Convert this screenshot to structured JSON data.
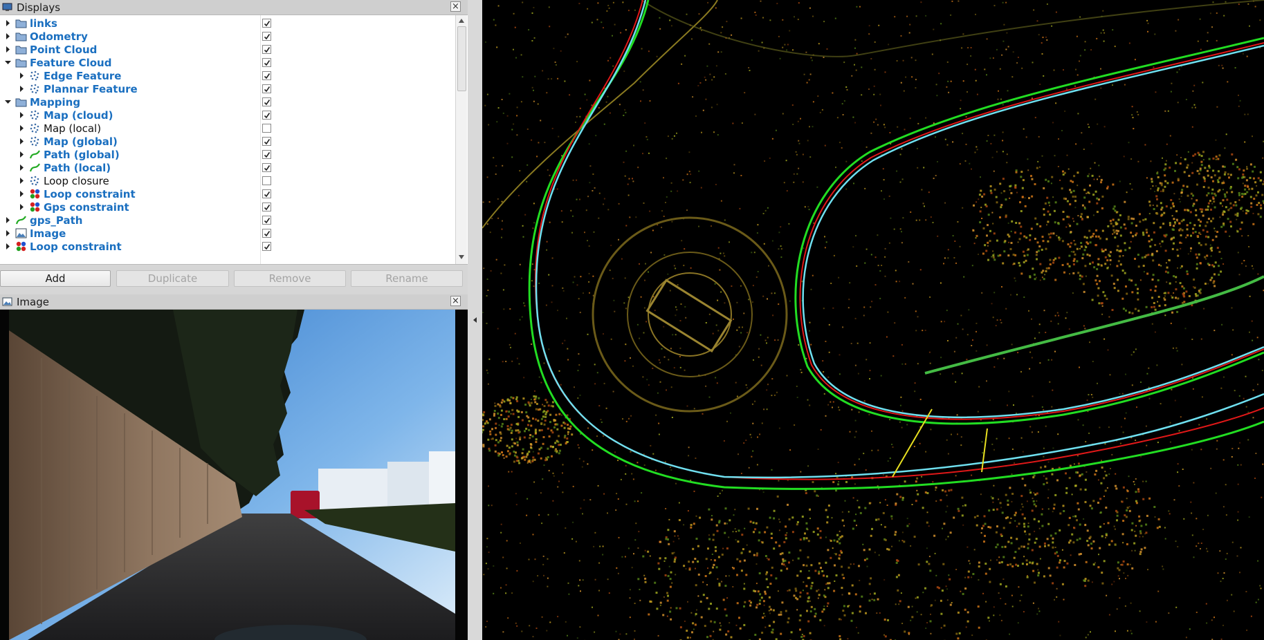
{
  "displays_panel": {
    "title": "Displays",
    "close_glyph": "×",
    "items": [
      {
        "label": "links",
        "indent": 0,
        "icon": "folder-icon",
        "expanded": false,
        "checked": true,
        "enabled": true
      },
      {
        "label": "Odometry",
        "indent": 0,
        "icon": "folder-icon",
        "expanded": false,
        "checked": true,
        "enabled": true
      },
      {
        "label": "Point Cloud",
        "indent": 0,
        "icon": "folder-icon",
        "expanded": false,
        "checked": true,
        "enabled": true
      },
      {
        "label": "Feature Cloud",
        "indent": 0,
        "icon": "folder-icon",
        "expanded": true,
        "checked": true,
        "enabled": true
      },
      {
        "label": "Edge Feature",
        "indent": 1,
        "icon": "pointcloud-icon",
        "expanded": false,
        "checked": true,
        "enabled": true
      },
      {
        "label": "Plannar Feature",
        "indent": 1,
        "icon": "pointcloud-icon",
        "expanded": false,
        "checked": true,
        "enabled": true
      },
      {
        "label": "Mapping",
        "indent": 0,
        "icon": "folder-icon",
        "expanded": true,
        "checked": true,
        "enabled": true
      },
      {
        "label": "Map (cloud)",
        "indent": 1,
        "icon": "pointcloud-icon",
        "expanded": false,
        "checked": true,
        "enabled": true
      },
      {
        "label": "Map (local)",
        "indent": 1,
        "icon": "pointcloud-icon",
        "expanded": false,
        "checked": false,
        "enabled": false
      },
      {
        "label": "Map (global)",
        "indent": 1,
        "icon": "pointcloud-icon",
        "expanded": false,
        "checked": true,
        "enabled": true
      },
      {
        "label": "Path (global)",
        "indent": 1,
        "icon": "path-icon",
        "expanded": false,
        "checked": true,
        "enabled": true
      },
      {
        "label": "Path (local)",
        "indent": 1,
        "icon": "path-icon",
        "expanded": false,
        "checked": true,
        "enabled": true
      },
      {
        "label": "Loop closure",
        "indent": 1,
        "icon": "pointcloud-icon",
        "expanded": false,
        "checked": false,
        "enabled": false
      },
      {
        "label": "Loop constraint",
        "indent": 1,
        "icon": "marker-icon",
        "expanded": false,
        "checked": true,
        "enabled": true
      },
      {
        "label": "Gps constraint",
        "indent": 1,
        "icon": "marker-icon",
        "expanded": false,
        "checked": true,
        "enabled": true
      },
      {
        "label": "gps_Path",
        "indent": 0,
        "icon": "path-icon",
        "expanded": false,
        "checked": true,
        "enabled": true
      },
      {
        "label": "Image",
        "indent": 0,
        "icon": "image-icon",
        "expanded": false,
        "checked": true,
        "enabled": true
      },
      {
        "label": "Loop constraint",
        "indent": 0,
        "icon": "marker-icon",
        "expanded": false,
        "checked": true,
        "enabled": true
      }
    ]
  },
  "buttons": {
    "add": "Add",
    "duplicate": "Duplicate",
    "remove": "Remove",
    "rename": "Rename"
  },
  "image_panel": {
    "title": "Image",
    "close_glyph": "×"
  },
  "colors": {
    "link_blue": "#1a6fc0",
    "path_green": "#22dd22",
    "path_red": "#e01818",
    "path_cyan": "#6fe0f0",
    "constraint_yellow": "#e8e020"
  }
}
